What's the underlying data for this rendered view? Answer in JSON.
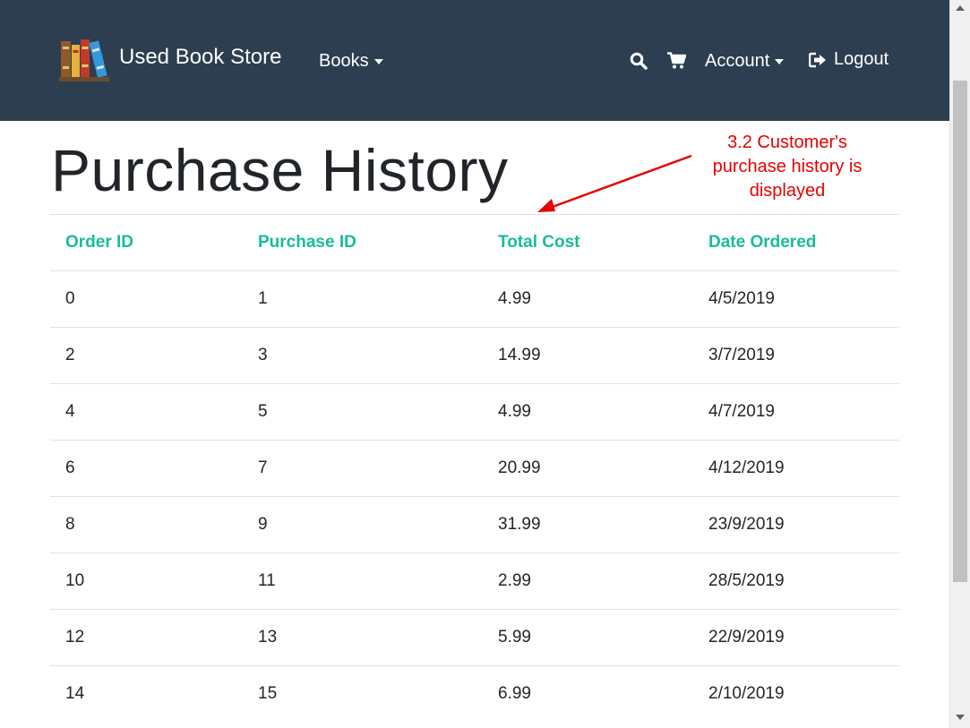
{
  "navbar": {
    "brand": "Used Book Store",
    "books": "Books",
    "account": "Account",
    "logout": "Logout",
    "background": "#2c3e50"
  },
  "page": {
    "title": "Purchase History"
  },
  "annotation": {
    "text": "3.2  Customer's purchase history is displayed",
    "color": "#e60000"
  },
  "table": {
    "headers": [
      "Order ID",
      "Purchase ID",
      "Total Cost",
      "Date Ordered"
    ],
    "header_color": "#18bc9c",
    "rows": [
      [
        "0",
        "1",
        "4.99",
        "4/5/2019"
      ],
      [
        "2",
        "3",
        "14.99",
        "3/7/2019"
      ],
      [
        "4",
        "5",
        "4.99",
        "4/7/2019"
      ],
      [
        "6",
        "7",
        "20.99",
        "4/12/2019"
      ],
      [
        "8",
        "9",
        "31.99",
        "23/9/2019"
      ],
      [
        "10",
        "11",
        "2.99",
        "28/5/2019"
      ],
      [
        "12",
        "13",
        "5.99",
        "22/9/2019"
      ],
      [
        "14",
        "15",
        "6.99",
        "2/10/2019"
      ]
    ]
  },
  "icons": [
    "books-logo-icon",
    "search-icon",
    "cart-icon",
    "logout-icon",
    "chevron-down-icon"
  ]
}
